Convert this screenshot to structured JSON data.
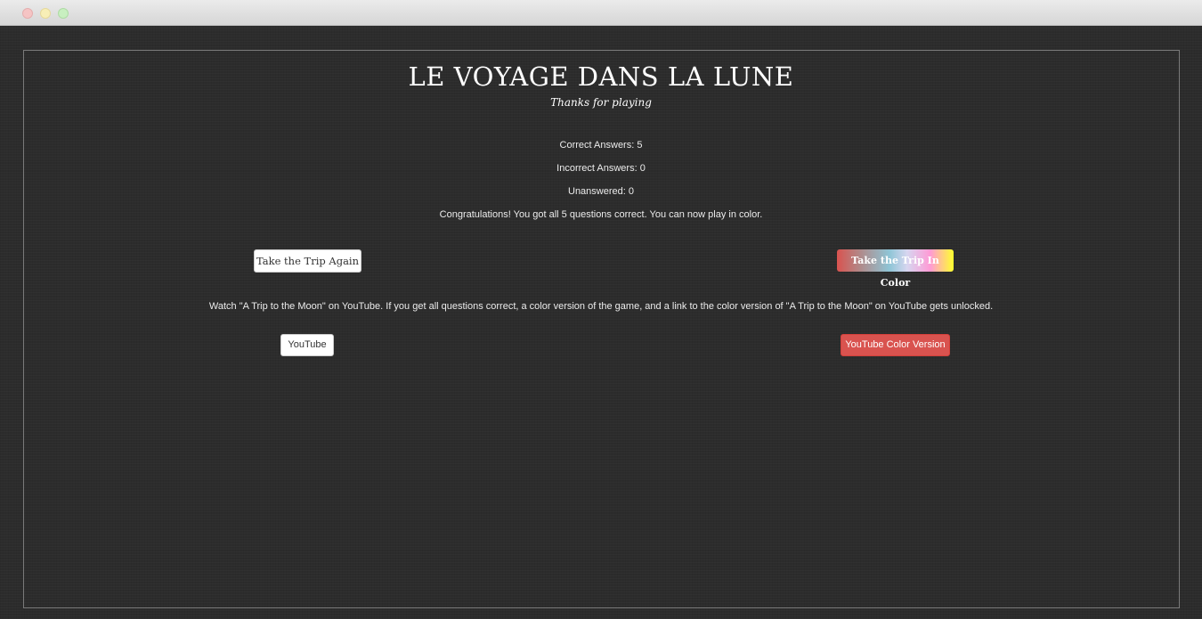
{
  "page": {
    "title": "LE VOYAGE DANS LA LUNE",
    "subtitle": "Thanks for playing"
  },
  "results": {
    "correct": "Correct Answers: 5",
    "incorrect": "Incorrect Answers: 0",
    "unanswered": "Unanswered: 0",
    "message": "Congratulations! You got all 5 questions correct. You can now play in color."
  },
  "buttons": {
    "play_again": "Take the Trip Again",
    "play_color": "Take the Trip In Color",
    "youtube": "YouTube",
    "youtube_color": "YouTube Color Version"
  },
  "info": {
    "text": "Watch \"A Trip to the Moon\" on YouTube. If you get all questions correct, a color version of the game, and a link to the color version of \"A Trip to the Moon\" on YouTube gets unlocked."
  },
  "colors": {
    "background": "#2c2c2c",
    "danger": "#d9534f",
    "text": "#ececec"
  }
}
